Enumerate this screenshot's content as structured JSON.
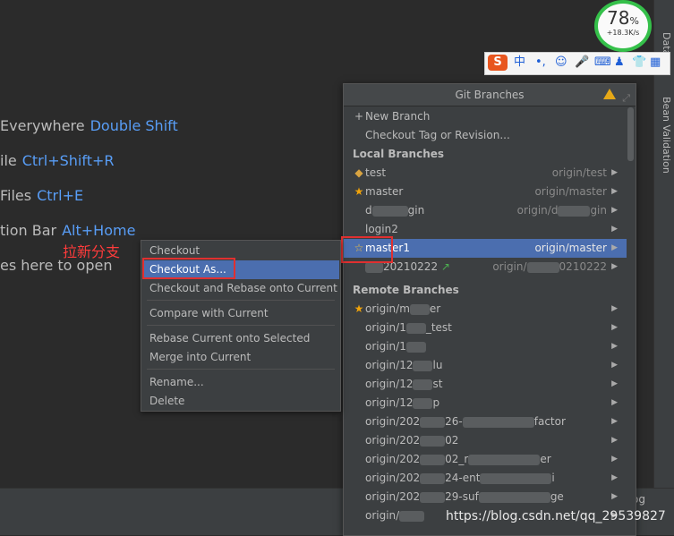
{
  "editor_hints": [
    {
      "text": "Everywhere",
      "key": "Double Shift"
    },
    {
      "text": "ile",
      "key": "Ctrl+Shift+R"
    },
    {
      "text": "Files",
      "key": "Ctrl+E"
    },
    {
      "text": "tion Bar",
      "key": "Alt+Home"
    },
    {
      "text": "es here to open",
      "key": ""
    }
  ],
  "right_tabs": {
    "database": "Data",
    "bean": "Bean Validation"
  },
  "bottom_partial_text": "og",
  "git_popup": {
    "title": "Git Branches",
    "actions": [
      "New Branch",
      "Checkout Tag or Revision..."
    ],
    "local_header": "Local Branches",
    "local": [
      {
        "name": "test",
        "origin": "origin/test",
        "icon": "tag"
      },
      {
        "name": "master",
        "origin": "origin/master",
        "icon": "star"
      },
      {
        "name": "d",
        "name_tail": "gin",
        "origin": "origin/d",
        "origin_tail": "gin",
        "icon": ""
      },
      {
        "name": "login2",
        "origin": "",
        "icon": ""
      },
      {
        "name": "master1",
        "origin": "origin/master",
        "icon": "star-outline"
      },
      {
        "name": "",
        "name_tail": "20210222",
        "origin": "origin/",
        "origin_tail": "0210222",
        "icon": "arrow"
      }
    ],
    "remote_header": "Remote Branches",
    "remote": [
      {
        "name": "origin/m",
        "tail": "er",
        "star": true
      },
      {
        "name": "origin/1",
        "tail": "_test",
        "star": false
      },
      {
        "name": "origin/1",
        "tail": "",
        "star": false
      },
      {
        "name": "origin/12",
        "tail": "lu",
        "star": false
      },
      {
        "name": "origin/12",
        "tail": "st",
        "star": false
      },
      {
        "name": "origin/12",
        "tail": "p",
        "star": false
      },
      {
        "name": "origin/202",
        "tail": "26-",
        "tail2": "factor",
        "star": false
      },
      {
        "name": "origin/202",
        "tail": "02",
        "star": false
      },
      {
        "name": "origin/202",
        "tail": "02_r",
        "tail2": "er",
        "star": false
      },
      {
        "name": "origin/202",
        "tail": "24-ent",
        "tail2": "i",
        "star": false
      },
      {
        "name": "origin/202",
        "tail": "29-suf",
        "tail2": "ge",
        "star": false
      },
      {
        "name": "origin/",
        "tail": "",
        "star": false
      }
    ]
  },
  "context_menu": {
    "items": [
      "Checkout",
      "Checkout As...",
      "Checkout and Rebase onto Current",
      "Compare with Current",
      "Rebase Current onto Selected",
      "Merge into Current",
      "Rename...",
      "Delete"
    ]
  },
  "annotation": "拉新分支",
  "net_meter": {
    "percent": "78",
    "unit": "%",
    "speed": "+18.3K/s"
  },
  "watermark": "https://blog.csdn.net/qq_29539827",
  "colors": {
    "selection": "#4b6eaf",
    "highlight_box": "#e03030",
    "shortcut": "#589df6",
    "meter_ring": "#35c04a"
  }
}
